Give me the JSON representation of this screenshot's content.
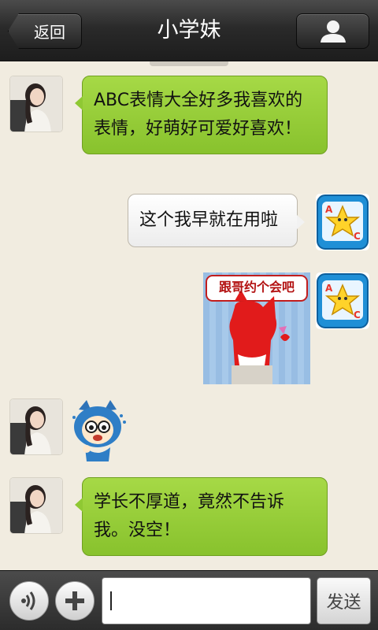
{
  "header": {
    "back_label": "返回",
    "title": "小学妹"
  },
  "messages": [
    {
      "sender": "contact",
      "type": "text",
      "text": "ABC表情大全好多我喜欢的表情，好萌好可爱好喜欢！"
    },
    {
      "sender": "me",
      "type": "text",
      "text": "这个我早就在用啦"
    },
    {
      "sender": "me",
      "type": "sticker",
      "caption": "跟哥约个会吧"
    },
    {
      "sender": "contact",
      "type": "sticker"
    },
    {
      "sender": "contact",
      "type": "text",
      "text": "学长不厚道，竟然不告诉我。没空！"
    }
  ],
  "composer": {
    "input_value": "",
    "send_label": "发送"
  },
  "colors": {
    "bar_dark": "#2a2a2a",
    "chat_bg": "#f1ece0",
    "bubble_green": "#98cc38",
    "bubble_white": "#f7f7f7",
    "app_icon_blue": "#1f8fd6"
  },
  "icons": {
    "profile": "person-silhouette-icon",
    "voice": "voice-wave-icon",
    "plus": "plus-icon"
  }
}
